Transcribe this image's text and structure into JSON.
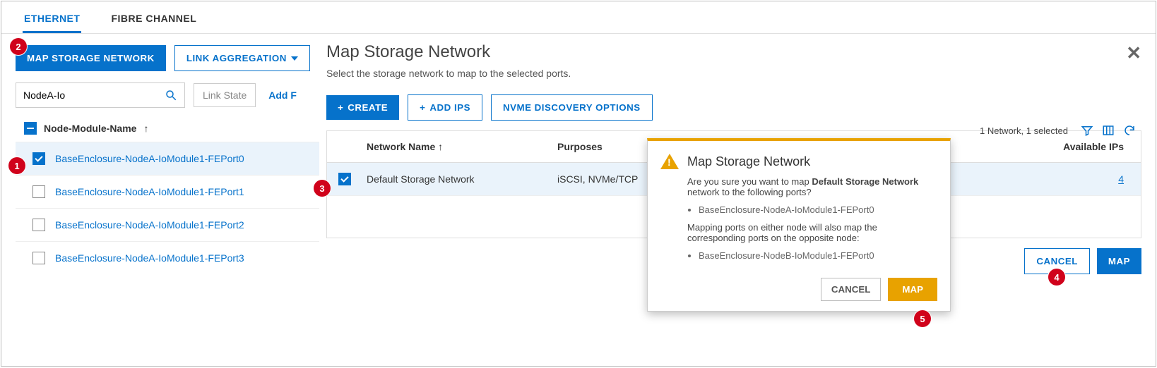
{
  "tabs": {
    "ethernet": "ETHERNET",
    "fibre": "FIBRE CHANNEL"
  },
  "toolbar": {
    "map_storage_network": "MAP STORAGE NETWORK",
    "link_aggregation": "LINK AGGREGATION"
  },
  "search": {
    "value": "NodeA-Io"
  },
  "link_state": "Link State",
  "add_link": "Add F",
  "port_table": {
    "group_header": "Node-Module-Name",
    "sort_indicator": "↑",
    "rows": [
      {
        "label": "BaseEnclosure-NodeA-IoModule1-FEPort0",
        "checked": true
      },
      {
        "label": "BaseEnclosure-NodeA-IoModule1-FEPort1",
        "checked": false
      },
      {
        "label": "BaseEnclosure-NodeA-IoModule1-FEPort2",
        "checked": false
      },
      {
        "label": "BaseEnclosure-NodeA-IoModule1-FEPort3",
        "checked": false
      }
    ]
  },
  "map_panel": {
    "title": "Map Storage Network",
    "subtitle": "Select the storage network to map to the selected ports.",
    "create": "CREATE",
    "add_ips": "ADD IPS",
    "nvme_discovery": "NVME DISCOVERY OPTIONS",
    "count_label": "1 Network, 1 selected",
    "columns": {
      "name": "Network Name",
      "purposes": "Purposes",
      "available_ips": "Available IPs",
      "sort": "↑"
    },
    "rows": [
      {
        "name": "Default Storage Network",
        "purposes": "iSCSI, NVMe/TCP",
        "available_ips": "4",
        "checked": true
      }
    ],
    "cancel": "CANCEL",
    "map": "MAP"
  },
  "confirm": {
    "title": "Map Storage Network",
    "line1_pre": "Are you sure you want to map ",
    "line1_bold": "Default Storage Network",
    "line1_post": " network to the following ports?",
    "bullet1": "BaseEnclosure-NodeA-IoModule1-FEPort0",
    "line2": "Mapping ports on either node will also map the corresponding ports on the opposite node:",
    "bullet2": "BaseEnclosure-NodeB-IoModule1-FEPort0",
    "cancel": "CANCEL",
    "map": "MAP"
  },
  "badges": {
    "b1": "1",
    "b2": "2",
    "b3": "3",
    "b4": "4",
    "b5": "5"
  }
}
